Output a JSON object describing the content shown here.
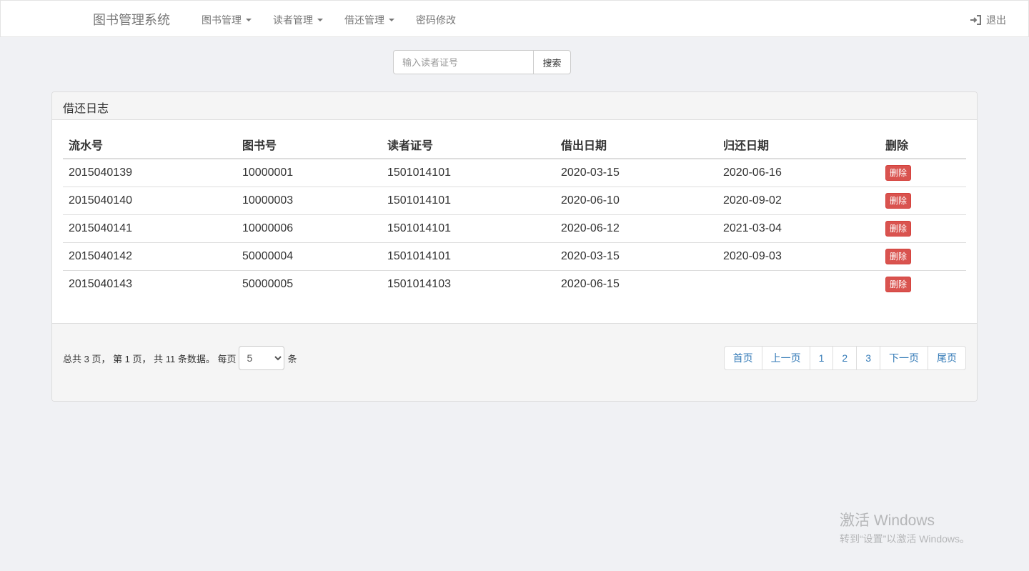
{
  "navbar": {
    "brand": "图书管理系统",
    "items": [
      {
        "label": "图书管理",
        "dropdown": true
      },
      {
        "label": "读者管理",
        "dropdown": true
      },
      {
        "label": "借还管理",
        "dropdown": true
      },
      {
        "label": "密码修改",
        "dropdown": false
      }
    ],
    "logout_label": "退出"
  },
  "search": {
    "placeholder": "输入读者证号",
    "value": "",
    "button_label": "搜索"
  },
  "panel": {
    "title": "借还日志",
    "columns": [
      "流水号",
      "图书号",
      "读者证号",
      "借出日期",
      "归还日期",
      "删除"
    ],
    "rows": [
      [
        "2015040139",
        "10000001",
        "1501014101",
        "2020-03-15",
        "2020-06-16"
      ],
      [
        "2015040140",
        "10000003",
        "1501014101",
        "2020-06-10",
        "2020-09-02"
      ],
      [
        "2015040141",
        "10000006",
        "1501014101",
        "2020-06-12",
        "2021-03-04"
      ],
      [
        "2015040142",
        "50000004",
        "1501014101",
        "2020-03-15",
        "2020-09-03"
      ],
      [
        "2015040143",
        "50000005",
        "1501014103",
        "2020-06-15",
        ""
      ]
    ],
    "delete_label": "删除"
  },
  "footer": {
    "info_prefix": "总共 3 页， 第 1 页， 共 11 条数据。 每页",
    "per_page_value": "5",
    "info_suffix": "条",
    "pagination": [
      "首页",
      "上一页",
      "1",
      "2",
      "3",
      "下一页",
      "尾页"
    ]
  },
  "watermark": {
    "title": "激活 Windows",
    "subtitle": "转到“设置”以激活 Windows。"
  },
  "colors": {
    "danger": "#d9534f",
    "link": "#337ab7",
    "background": "#f0f1f4"
  }
}
